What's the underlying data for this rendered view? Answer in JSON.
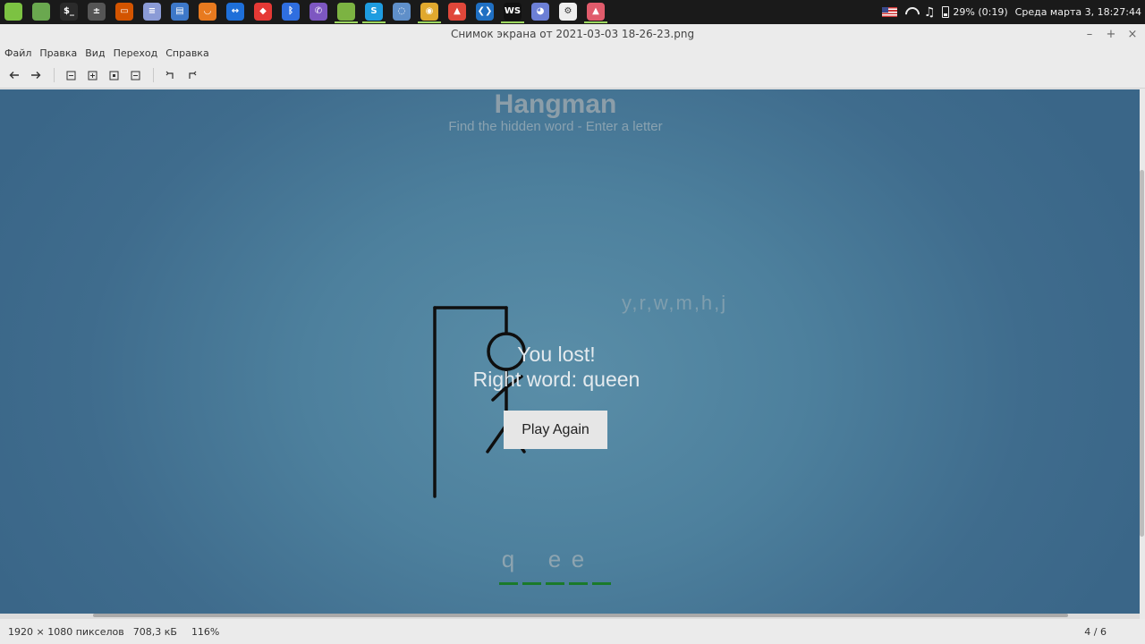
{
  "taskbar": {
    "apps": [
      {
        "name": "mint-menu",
        "color": "#7cc242",
        "glyph": "",
        "open": false
      },
      {
        "name": "show-desktop",
        "color": "#6aa84f",
        "glyph": "",
        "open": false
      },
      {
        "name": "terminal",
        "color": "#2b2b2b",
        "glyph": "$_",
        "open": false
      },
      {
        "name": "calculator",
        "color": "#555555",
        "glyph": "±",
        "open": false
      },
      {
        "name": "impress",
        "color": "#d35400",
        "glyph": "▭",
        "open": false
      },
      {
        "name": "text-editor",
        "color": "#8b9bd6",
        "glyph": "≡",
        "open": false
      },
      {
        "name": "writer",
        "color": "#3d78c9",
        "glyph": "▤",
        "open": false
      },
      {
        "name": "firefox",
        "color": "#e87a1f",
        "glyph": "◡",
        "open": false
      },
      {
        "name": "teamviewer",
        "color": "#1e6fd9",
        "glyph": "↔",
        "open": false
      },
      {
        "name": "anydesk",
        "color": "#e53935",
        "glyph": "◆",
        "open": false
      },
      {
        "name": "bluetooth",
        "color": "#2f6ee0",
        "glyph": "ᛒ",
        "open": false
      },
      {
        "name": "viber",
        "color": "#7d57c1",
        "glyph": "✆",
        "open": false
      },
      {
        "name": "files",
        "color": "#7cb342",
        "glyph": "",
        "open": true
      },
      {
        "name": "skype",
        "color": "#1e9ce0",
        "glyph": "S",
        "open": true
      },
      {
        "name": "virtualbox",
        "color": "#5f8fc9",
        "glyph": "◌",
        "open": false
      },
      {
        "name": "chrome",
        "color": "#e0a82e",
        "glyph": "◉",
        "open": true
      },
      {
        "name": "postman",
        "color": "#e0473a",
        "glyph": "▲",
        "open": false
      },
      {
        "name": "vscode",
        "color": "#1f6fc2",
        "glyph": "❮❯",
        "open": false
      },
      {
        "name": "webstorm",
        "color": "#111111",
        "glyph": "WS",
        "open": true
      },
      {
        "name": "discord",
        "color": "#6c7fd6",
        "glyph": "◕",
        "open": false
      },
      {
        "name": "settings",
        "color": "#eeeeee",
        "glyph": "⚙",
        "open": false
      },
      {
        "name": "image-viewer",
        "color": "#e05b6b",
        "glyph": "▲",
        "open": true
      }
    ],
    "tray": {
      "battery": "29% (0:19)",
      "datetime": "Среда марта  3, 18:27:44"
    }
  },
  "window": {
    "title": "Снимок экрана от 2021-03-03 18-26-23.png",
    "controls": [
      "–",
      "+",
      "×"
    ]
  },
  "menu": [
    "Файл",
    "Правка",
    "Вид",
    "Переход",
    "Справка"
  ],
  "toolbar": {
    "buttons": [
      {
        "name": "back-icon",
        "glyph": "🡐"
      },
      {
        "name": "forward-icon",
        "glyph": "🡒"
      },
      {
        "name": "zoom-out-icon",
        "glyph": "⊟"
      },
      {
        "name": "zoom-in-icon",
        "glyph": "⊞"
      },
      {
        "name": "zoom-fit-icon",
        "glyph": "⊡"
      },
      {
        "name": "zoom-original-icon",
        "glyph": "⊡"
      },
      {
        "name": "rotate-left-icon",
        "glyph": "↶"
      },
      {
        "name": "rotate-right-icon",
        "glyph": "↷"
      }
    ]
  },
  "game": {
    "title": "Hangman",
    "subtitle": "Find the hidden word - Enter a letter",
    "wrong_letters": "y,r,w,m,h,j",
    "lost_message": "You lost!",
    "right_word_message": "Right word: queen",
    "play_again": "Play Again",
    "word_slots": [
      "q",
      "",
      "e",
      "e",
      ""
    ]
  },
  "status": {
    "dimensions": "1920 × 1080 пикселов",
    "size": "708,3 кБ",
    "zoom": "116%",
    "counter": "4 / 6"
  }
}
